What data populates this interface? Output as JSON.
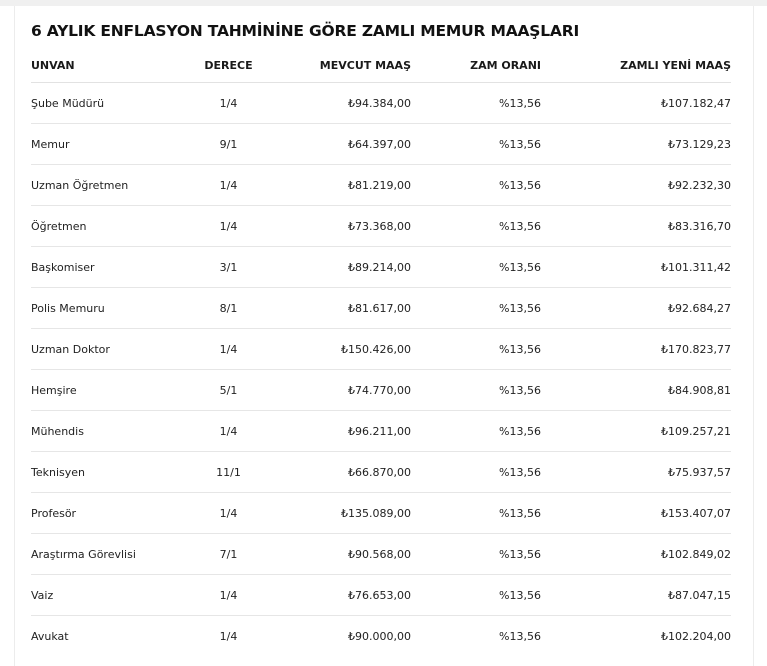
{
  "title": "6 AYLIK ENFLASYON TAHMİNİNE GÖRE ZAMLI MEMUR MAAŞLARI",
  "table": {
    "headers": [
      "UNVAN",
      "DERECE",
      "MEVCUT MAAŞ",
      "ZAM ORANI",
      "ZAMLI YENİ MAAŞ"
    ],
    "rows": [
      [
        "Şube Müdürü",
        "1/4",
        "₺94.384,00",
        "%13,56",
        "₺107.182,47"
      ],
      [
        "Memur",
        "9/1",
        "₺64.397,00",
        "%13,56",
        "₺73.129,23"
      ],
      [
        "Uzman Öğretmen",
        "1/4",
        "₺81.219,00",
        "%13,56",
        "₺92.232,30"
      ],
      [
        "Öğretmen",
        "1/4",
        "₺73.368,00",
        "%13,56",
        "₺83.316,70"
      ],
      [
        "Başkomiser",
        "3/1",
        "₺89.214,00",
        "%13,56",
        "₺101.311,42"
      ],
      [
        "Polis Memuru",
        "8/1",
        "₺81.617,00",
        "%13,56",
        "₺92.684,27"
      ],
      [
        "Uzman Doktor",
        "1/4",
        "₺150.426,00",
        "%13,56",
        "₺170.823,77"
      ],
      [
        "Hemşire",
        "5/1",
        "₺74.770,00",
        "%13,56",
        "₺84.908,81"
      ],
      [
        "Mühendis",
        "1/4",
        "₺96.211,00",
        "%13,56",
        "₺109.257,21"
      ],
      [
        "Teknisyen",
        "11/1",
        "₺66.870,00",
        "%13,56",
        "₺75.937,57"
      ],
      [
        "Profesör",
        "1/4",
        "₺135.089,00",
        "%13,56",
        "₺153.407,07"
      ],
      [
        "Araştırma Görevlisi",
        "7/1",
        "₺90.568,00",
        "%13,56",
        "₺102.849,02"
      ],
      [
        "Vaiz",
        "1/4",
        "₺76.653,00",
        "%13,56",
        "₺87.047,15"
      ],
      [
        "Avukat",
        "1/4",
        "₺90.000,00",
        "%13,56",
        "₺102.204,00"
      ]
    ]
  }
}
